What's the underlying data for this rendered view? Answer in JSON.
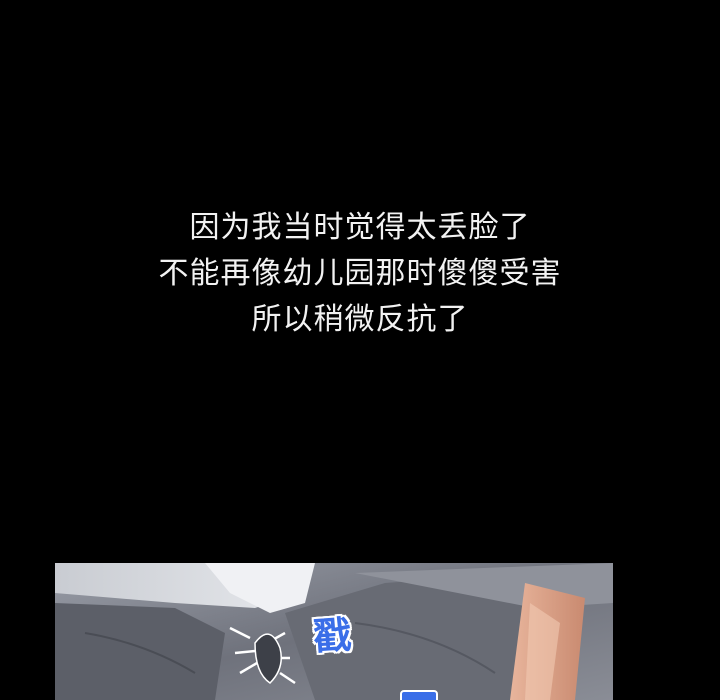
{
  "caption": {
    "lines": [
      "因为我当时觉得太丢脸了",
      "不能再像幼儿园那时傻傻受害",
      "所以稍微反抗了"
    ]
  },
  "panel": {
    "sound_effect": "戳"
  },
  "colors": {
    "background": "#000000",
    "caption_text": "#f2f2f2",
    "sound_effect": "#3a6ee8"
  }
}
